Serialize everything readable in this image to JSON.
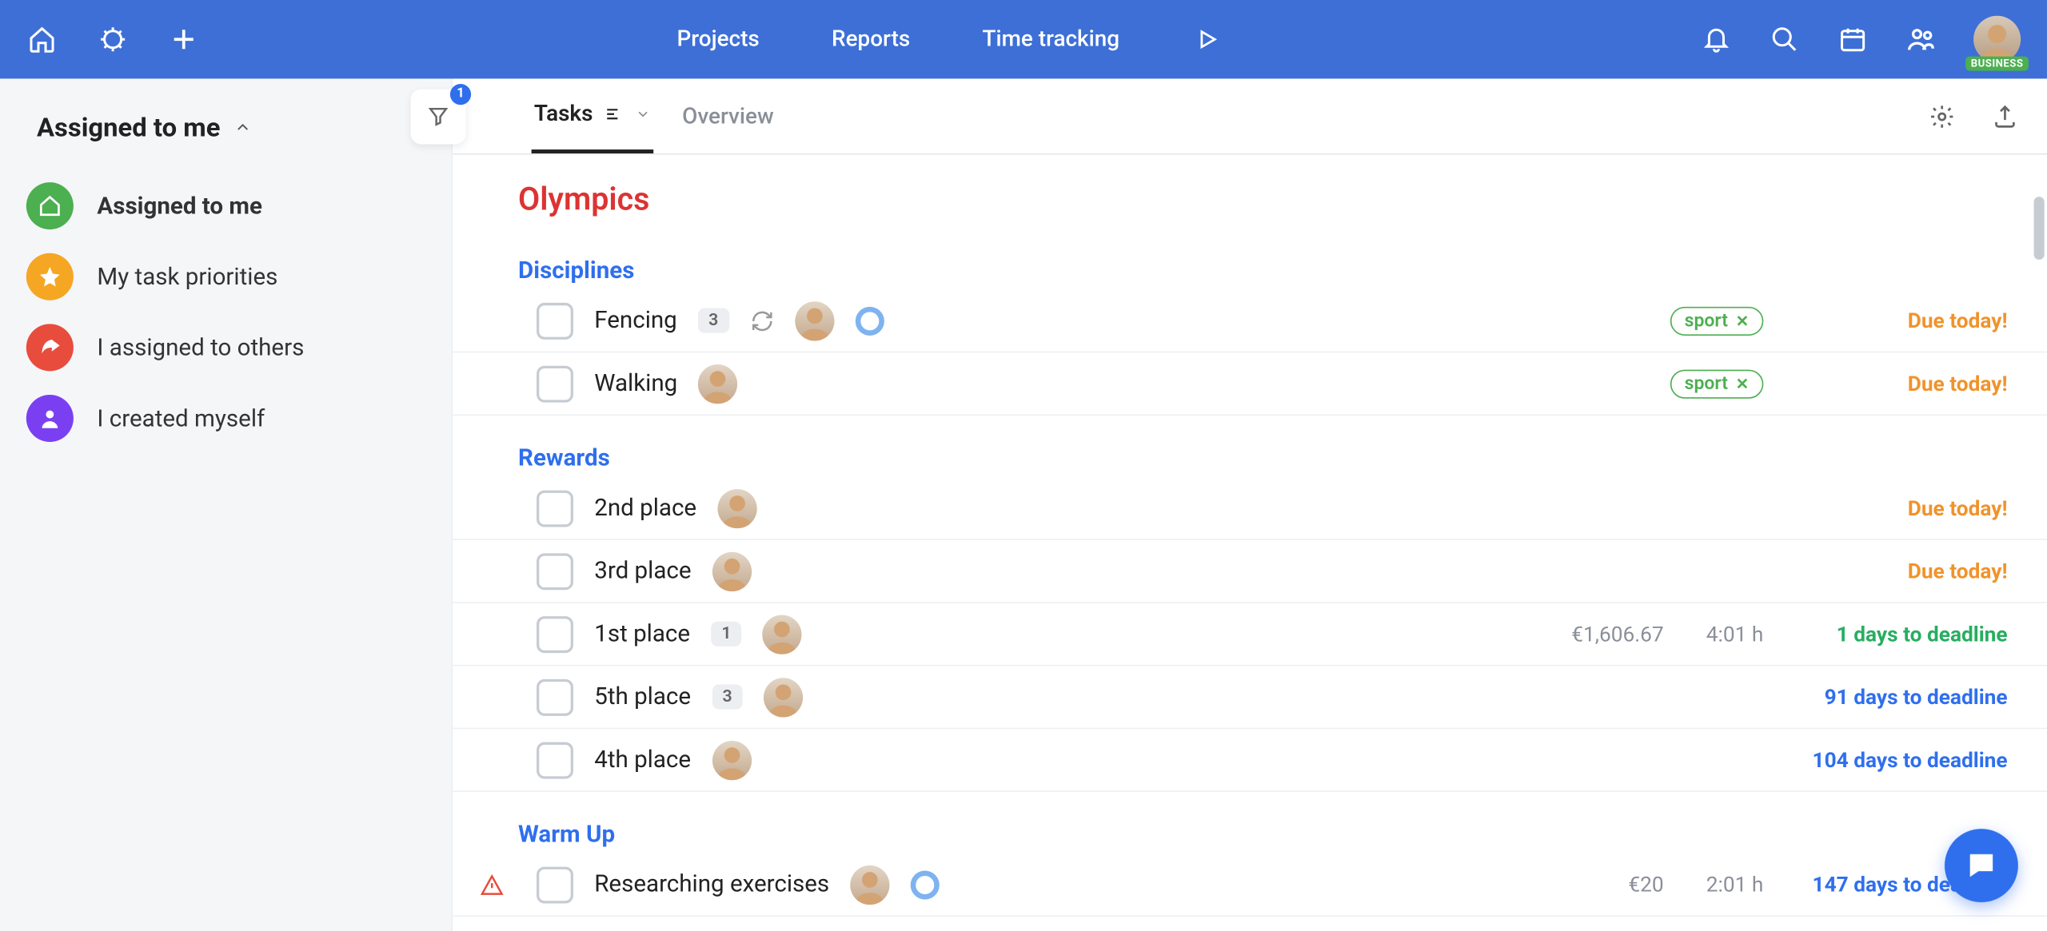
{
  "topbar": {
    "nav": {
      "projects": "Projects",
      "reports": "Reports",
      "time_tracking": "Time tracking"
    },
    "badge": "BUSINESS"
  },
  "sidebar": {
    "title": "Assigned to me",
    "items": [
      {
        "label": "Assigned to me"
      },
      {
        "label": "My task priorities"
      },
      {
        "label": "I assigned to others"
      },
      {
        "label": "I created myself"
      }
    ]
  },
  "tabs": {
    "filter_count": "1",
    "tasks": "Tasks",
    "overview": "Overview"
  },
  "project": {
    "title": "Olympics"
  },
  "sections": [
    {
      "title": "Disciplines",
      "tasks": [
        {
          "name": "Fencing",
          "count": "3",
          "repeat": true,
          "avatar": true,
          "circle": true,
          "tag": "sport",
          "deadline": "Due today!",
          "deadline_class": "d-orange"
        },
        {
          "name": "Walking",
          "avatar": true,
          "tag": "sport",
          "deadline": "Due today!",
          "deadline_class": "d-orange"
        }
      ]
    },
    {
      "title": "Rewards",
      "tasks": [
        {
          "name": "2nd place",
          "avatar": true,
          "deadline": "Due today!",
          "deadline_class": "d-orange"
        },
        {
          "name": "3rd place",
          "avatar": true,
          "deadline": "Due today!",
          "deadline_class": "d-orange"
        },
        {
          "name": "1st place",
          "count": "1",
          "avatar": true,
          "money": "€1,606.67",
          "time": "4:01 h",
          "deadline": "1 days to deadline",
          "deadline_class": "d-green"
        },
        {
          "name": "5th place",
          "count": "3",
          "avatar": true,
          "deadline": "91 days to deadline",
          "deadline_class": "d-blue"
        },
        {
          "name": "4th place",
          "avatar": true,
          "deadline": "104 days to deadline",
          "deadline_class": "d-blue"
        }
      ]
    },
    {
      "title": "Warm Up",
      "tasks": [
        {
          "name": "Researching exercises",
          "alert": true,
          "avatar": true,
          "circle": true,
          "money": "€20",
          "time": "2:01 h",
          "deadline": "147 days to deadline",
          "deadline_class": "d-blue"
        }
      ]
    }
  ]
}
